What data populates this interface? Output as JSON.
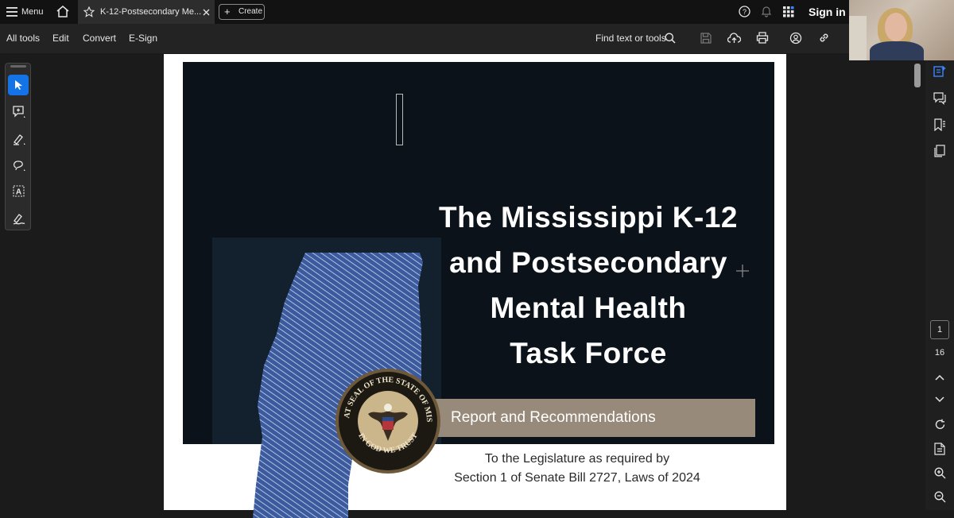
{
  "topbar": {
    "menu_label": "Menu",
    "tab_title": "K-12-Postsecondary Me...",
    "create_label": "Create",
    "sign_in_label": "Sign in"
  },
  "toolbar": {
    "all_tools": "All tools",
    "edit": "Edit",
    "convert": "Convert",
    "esign": "E-Sign",
    "find_label": "Find text or tools"
  },
  "page_nav": {
    "current_page": "1",
    "total_pages": "16"
  },
  "document": {
    "title_lines": [
      "The Mississippi K-12",
      "and Postsecondary",
      "Mental Health",
      "Task Force"
    ],
    "banner": "Report and Recommendations",
    "subtitle_1": "To the Legislature as required by",
    "subtitle_2": "Section 1 of Senate Bill 2727, Laws of 2024",
    "seal_text_top": "THE GREAT SEAL OF THE STATE OF MISSISSIPPI",
    "seal_text_bottom": "IN GOD WE TRUST"
  },
  "colors": {
    "accent": "#1473e6",
    "cover_bg": "#0c1219",
    "banner_bg": "#988a7a"
  }
}
